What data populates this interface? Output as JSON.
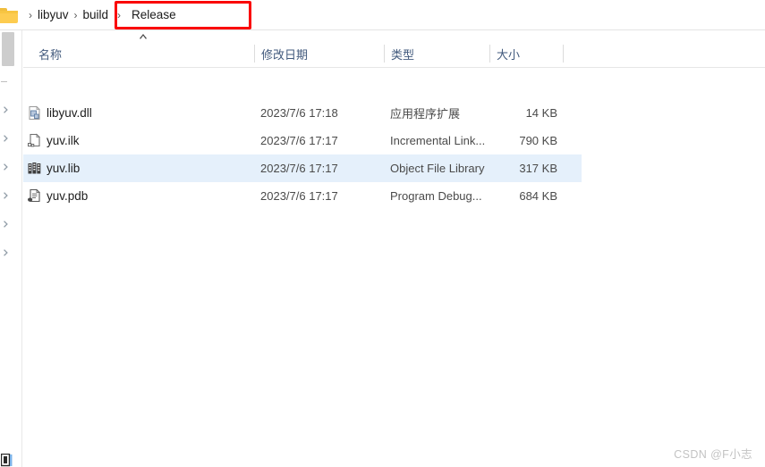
{
  "breadcrumb": {
    "folder_icon": "folder-icon",
    "separator": "›",
    "items": [
      {
        "label": "libyuv",
        "highlighted": false
      },
      {
        "label": "build",
        "highlighted": false
      },
      {
        "label": "Release",
        "highlighted": true
      }
    ],
    "highlight_color": "#fa0505"
  },
  "nav_pane": {
    "scrollbar": "vertical-scrollbar",
    "chevron_icon": "chevron-right-icon",
    "chevron_count": 6
  },
  "columns": {
    "name": "名称",
    "date_modified": "修改日期",
    "type": "类型",
    "size": "大小",
    "sort_indicator": "sort-ascending-caret"
  },
  "files": [
    {
      "name": "libyuv.dll",
      "date": "2023/7/6 17:18",
      "type": "应用程序扩展",
      "size": "14 KB",
      "icon": "dll-file-icon",
      "selected": false
    },
    {
      "name": "yuv.ilk",
      "date": "2023/7/6 17:17",
      "type": "Incremental Link...",
      "size": "790 KB",
      "icon": "ilk-file-icon",
      "selected": false
    },
    {
      "name": "yuv.lib",
      "date": "2023/7/6 17:17",
      "type": "Object File Library",
      "size": "317 KB",
      "icon": "lib-file-icon",
      "selected": true
    },
    {
      "name": "yuv.pdb",
      "date": "2023/7/6 17:17",
      "type": "Program Debug...",
      "size": "684 KB",
      "icon": "pdb-file-icon",
      "selected": false
    }
  ],
  "selection_color": "#e5f0fb",
  "watermark": "CSDN @F小志"
}
